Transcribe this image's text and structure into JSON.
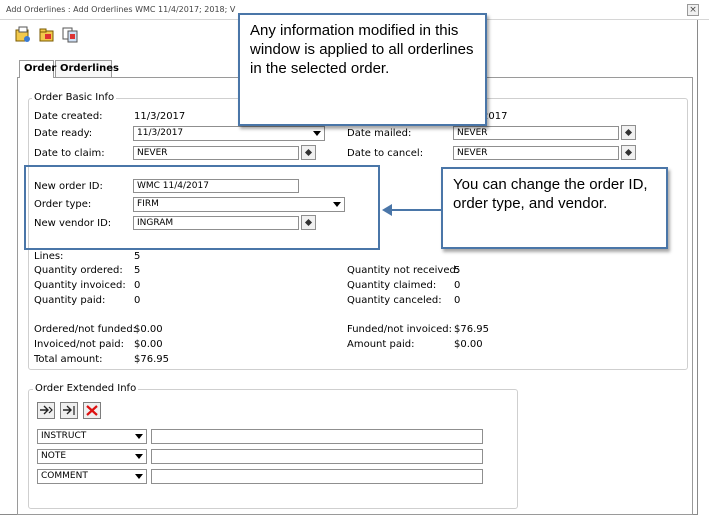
{
  "window": {
    "title": "Add Orderlines : Add Orderlines  WMC 11/4/2017; 2018; V"
  },
  "toolbar": {
    "icons": [
      "order-tool-icon",
      "folder-tool-icon",
      "copy-tool-icon"
    ]
  },
  "tabs": [
    {
      "label": "Order",
      "active": true
    },
    {
      "label": "Orderlines",
      "active": false
    }
  ],
  "basic_info": {
    "title": "Order Basic Info",
    "date_created_label": "Date created:",
    "date_created_value": "11/3/2017",
    "date_created_right_value": "2017",
    "date_ready_label": "Date ready:",
    "date_ready_value": "11/3/2017",
    "date_mailed_label": "Date mailed:",
    "date_mailed_value": "NEVER",
    "date_to_claim_label": "Date to claim:",
    "date_to_claim_value": "NEVER",
    "date_to_cancel_label": "Date to cancel:",
    "date_to_cancel_value": "NEVER",
    "new_order_id_label": "New order ID:",
    "new_order_id_value": "WMC 11/4/2017",
    "order_type_label": "Order type:",
    "order_type_value": "FIRM",
    "new_vendor_id_label": "New vendor ID:",
    "new_vendor_id_value": "INGRAM",
    "lines_label": "Lines:",
    "lines_value": "5",
    "qty_ordered_label": "Quantity ordered:",
    "qty_ordered_value": "5",
    "qty_not_received_label": "Quantity not received:",
    "qty_not_received_value": "5",
    "qty_invoiced_label": "Quantity invoiced:",
    "qty_invoiced_value": "0",
    "qty_claimed_label": "Quantity claimed:",
    "qty_claimed_value": "0",
    "qty_paid_label": "Quantity paid:",
    "qty_paid_value": "0",
    "qty_canceled_label": "Quantity canceled:",
    "qty_canceled_value": "0",
    "ordered_not_funded_label": "Ordered/not funded:",
    "ordered_not_funded_value": "$0.00",
    "funded_not_invoiced_label": "Funded/not invoiced:",
    "funded_not_invoiced_value": "$76.95",
    "invoiced_not_paid_label": "Invoiced/not paid:",
    "invoiced_not_paid_value": "$0.00",
    "amount_paid_label": "Amount paid:",
    "amount_paid_value": "$0.00",
    "total_amount_label": "Total amount:",
    "total_amount_value": "$76.95"
  },
  "extended_info": {
    "title": "Order Extended Info",
    "rows": [
      {
        "type": "INSTRUCT",
        "value": ""
      },
      {
        "type": "NOTE",
        "value": ""
      },
      {
        "type": "COMMENT",
        "value": ""
      }
    ]
  },
  "callouts": {
    "top": "Any information modified in this window is applied to all orderlines in the selected order.",
    "right": "You can change the order ID, order type, and vendor."
  },
  "colors": {
    "callout_border": "#4a76a8"
  }
}
